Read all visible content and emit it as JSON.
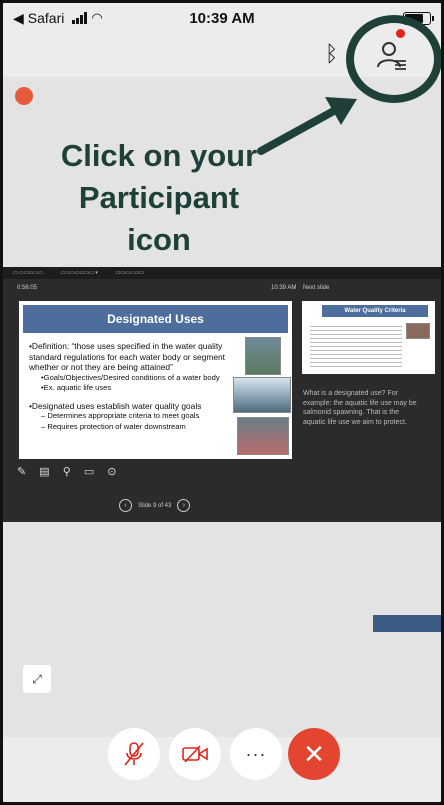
{
  "status_bar": {
    "back_app": "Safari",
    "time": "10:39 AM"
  },
  "toolbar": {
    "bluetooth_icon": "bluetooth-icon",
    "participant_icon": "participants-icon",
    "notification_color": "#e2231a"
  },
  "annotation": {
    "text_lines": [
      "Click on your",
      "Participant",
      "icon"
    ],
    "color": "#1e4039"
  },
  "shared_screen": {
    "time_left": "0:56:05",
    "clock": "10:39 AM",
    "next_label": "Next slide",
    "slide": {
      "title": "Designated Uses",
      "bullets": [
        {
          "level": 1,
          "text": "•Definition: “those uses specified in the water quality standard regulations for each water body or segment whether or not they are being attained”"
        },
        {
          "level": 2,
          "text": "•Goals/Objectives/Desired conditions of a water body"
        },
        {
          "level": 2,
          "text": "•Ex. aquatic life uses"
        },
        {
          "level": 0,
          "text": ""
        },
        {
          "level": 1,
          "text": "•Designated uses establish water quality goals"
        },
        {
          "level": 2,
          "text": "–  Determines appropriate criteria to meet goals"
        },
        {
          "level": 2,
          "text": "–  Requires protection of water downstream"
        }
      ]
    },
    "next_slide_title": "Water Quality Criteria",
    "slide_nav": "Slide 9 of 43",
    "notes": "What is a designated use? For example: the aquatic life use may be salmonid spawning. That is the aquatic life use we aim to protect."
  },
  "controls": {
    "mute_icon": "mic-muted-icon",
    "video_icon": "video-off-icon",
    "more_icon": "more-icon",
    "end_icon": "end-call-icon",
    "end_color": "#e34530"
  }
}
